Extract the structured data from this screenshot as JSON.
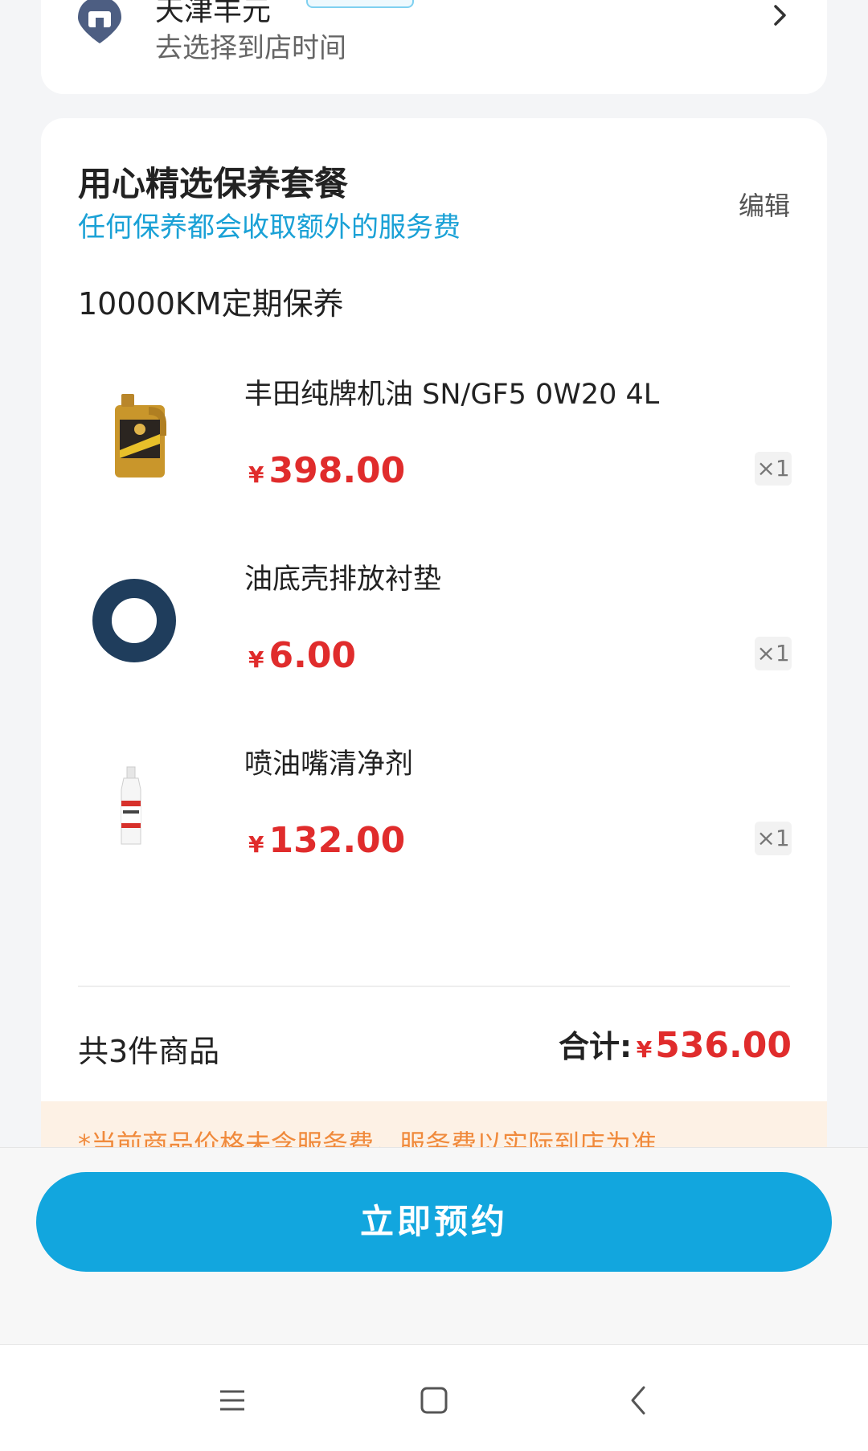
{
  "store": {
    "name": "天津丰元",
    "subtitle": "去选择到店时间"
  },
  "package": {
    "title": "用心精选保养套餐",
    "notice": "任何保养都会收取额外的服务费",
    "edit_label": "编辑",
    "plan_name": "10000KM定期保养",
    "items": [
      {
        "name": "丰田纯牌机油  SN/GF5 0W20 4L",
        "currency": "¥",
        "price": "398.00",
        "qty": "×1",
        "icon": "oil-bottle-icon"
      },
      {
        "name": "油底壳排放衬垫",
        "currency": "¥",
        "price": "6.00",
        "qty": "×1",
        "icon": "gasket-icon"
      },
      {
        "name": "喷油嘴清净剂",
        "currency": "¥",
        "price": "132.00",
        "qty": "×1",
        "icon": "cleaner-bottle-icon"
      }
    ],
    "count_text": "共3件商品",
    "total_label": "合计:",
    "total_currency": "¥",
    "total_amount": "536.00"
  },
  "footer_notice": "*当前商品价格未含服务费，服务费以实际到店为准",
  "book_button": "立即预约",
  "nav": {
    "menu": "menu-icon",
    "home": "home-icon",
    "back": "back-icon"
  },
  "colors": {
    "accent": "#12a6de",
    "price": "#e02c2c",
    "notice_text": "#f08a3c"
  }
}
